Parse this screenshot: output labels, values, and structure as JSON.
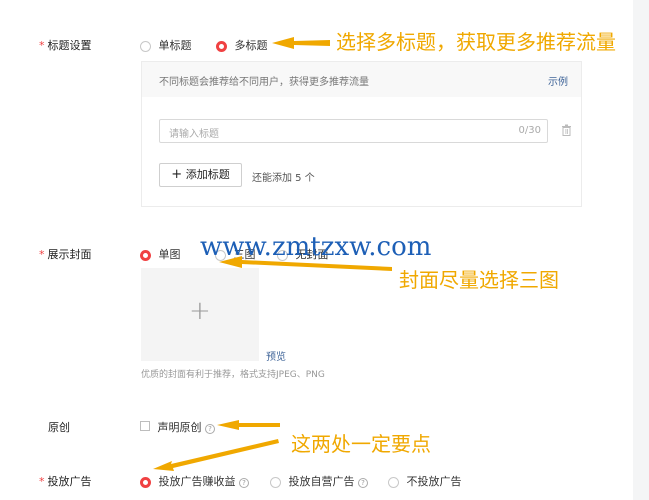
{
  "title_settings": {
    "label": "标题设置",
    "required_mark": "*",
    "options": [
      "单标题",
      "多标题"
    ],
    "selected": "多标题",
    "info": "不同标题会推荐给不同用户，获得更多推荐流量",
    "example_link": "示例",
    "input_placeholder": "请输入标题",
    "char_count": "0/30",
    "add_button": "添加标题",
    "add_icon": "+",
    "remaining": "还能添加 5 个"
  },
  "cover": {
    "label": "展示封面",
    "required_mark": "*",
    "options": [
      "单图",
      "三图",
      "无封面"
    ],
    "selected": "单图",
    "upload_icon": "+",
    "preview_link": "预览",
    "hint": "优质的封面有利于推荐，格式支持JPEG、PNG"
  },
  "original": {
    "label": "原创",
    "checkbox_label": "声明原创",
    "help": "?"
  },
  "ads": {
    "label": "投放广告",
    "required_mark": "*",
    "options": [
      "投放广告赚收益",
      "投放自营广告",
      "不投放广告"
    ],
    "selected": "投放广告赚收益",
    "help": "?"
  },
  "annotations": {
    "title_note": "选择多标题，获取更多推荐流量",
    "cover_note": "封面尽量选择三图",
    "points_note": "这两处一定要点",
    "color": "#f0a800"
  },
  "watermark": "www.zmtzxw.com",
  "colors": {
    "accent": "#f04142",
    "link": "#406599"
  }
}
